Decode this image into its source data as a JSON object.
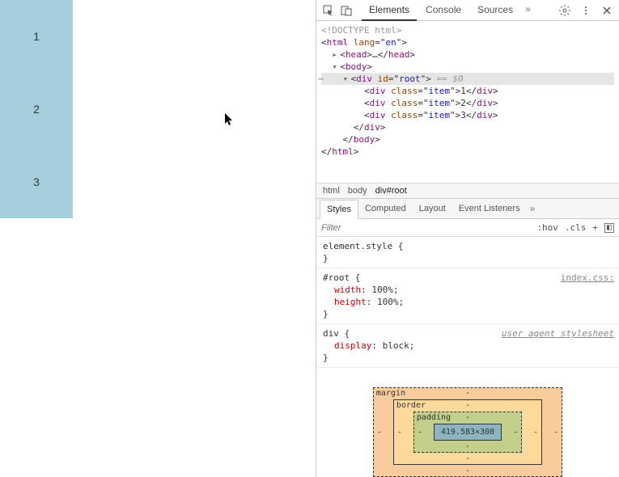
{
  "items": [
    "1",
    "2",
    "3"
  ],
  "tabs": {
    "elements": "Elements",
    "console": "Console",
    "sources": "Sources"
  },
  "dom": {
    "doctype": "<!DOCTYPE html>",
    "html_open": "html",
    "html_lang_attr": "lang",
    "html_lang_val": "en",
    "head": "head",
    "ellipsis": "…",
    "body": "body",
    "div": "div",
    "id_attr": "id",
    "root_val": "root",
    "eq0": " == $0",
    "class_attr": "class",
    "item_val": "item"
  },
  "breadcrumb": {
    "html": "html",
    "body": "body",
    "root": "div#root"
  },
  "styleTabs": {
    "styles": "Styles",
    "computed": "Computed",
    "layout": "Layout",
    "events": "Event Listeners"
  },
  "filter": {
    "placeholder": "Filter",
    "hov": ":hov",
    "cls": ".cls",
    "plus": "+"
  },
  "rules": {
    "element_style": "element.style {",
    "root_sel": "#root {",
    "width_n": "width",
    "width_v": "100%",
    "height_n": "height",
    "height_v": "100%",
    "root_src": "index.css:",
    "div_sel": "div {",
    "display_n": "display",
    "display_v": "block",
    "ua": "user agent stylesheet",
    "close": "}"
  },
  "boxmodel": {
    "margin": "margin",
    "border": "border",
    "padding": "padding",
    "content": "419.583×300",
    "dash": "-"
  }
}
